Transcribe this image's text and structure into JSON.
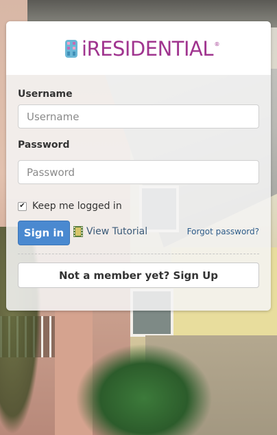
{
  "brand": {
    "name": "iRESIDENTIAL",
    "registered_mark": "®",
    "logo_icon": "residential-building-logo-icon",
    "color": "#a0358f"
  },
  "login_form": {
    "username_label": "Username",
    "username_placeholder": "Username",
    "username_value": "",
    "password_label": "Password",
    "password_placeholder": "Password",
    "password_value": "",
    "remember_label": "Keep me logged in",
    "remember_checked": true,
    "signin_label": "Sign in",
    "tutorial_label": "View Tutorial",
    "tutorial_icon": "film-icon",
    "forgot_label": "Forgot password?",
    "signup_label": "Not a member yet? Sign Up"
  },
  "colors": {
    "primary_button": "#4a89d0",
    "link": "#2d5c8a"
  }
}
